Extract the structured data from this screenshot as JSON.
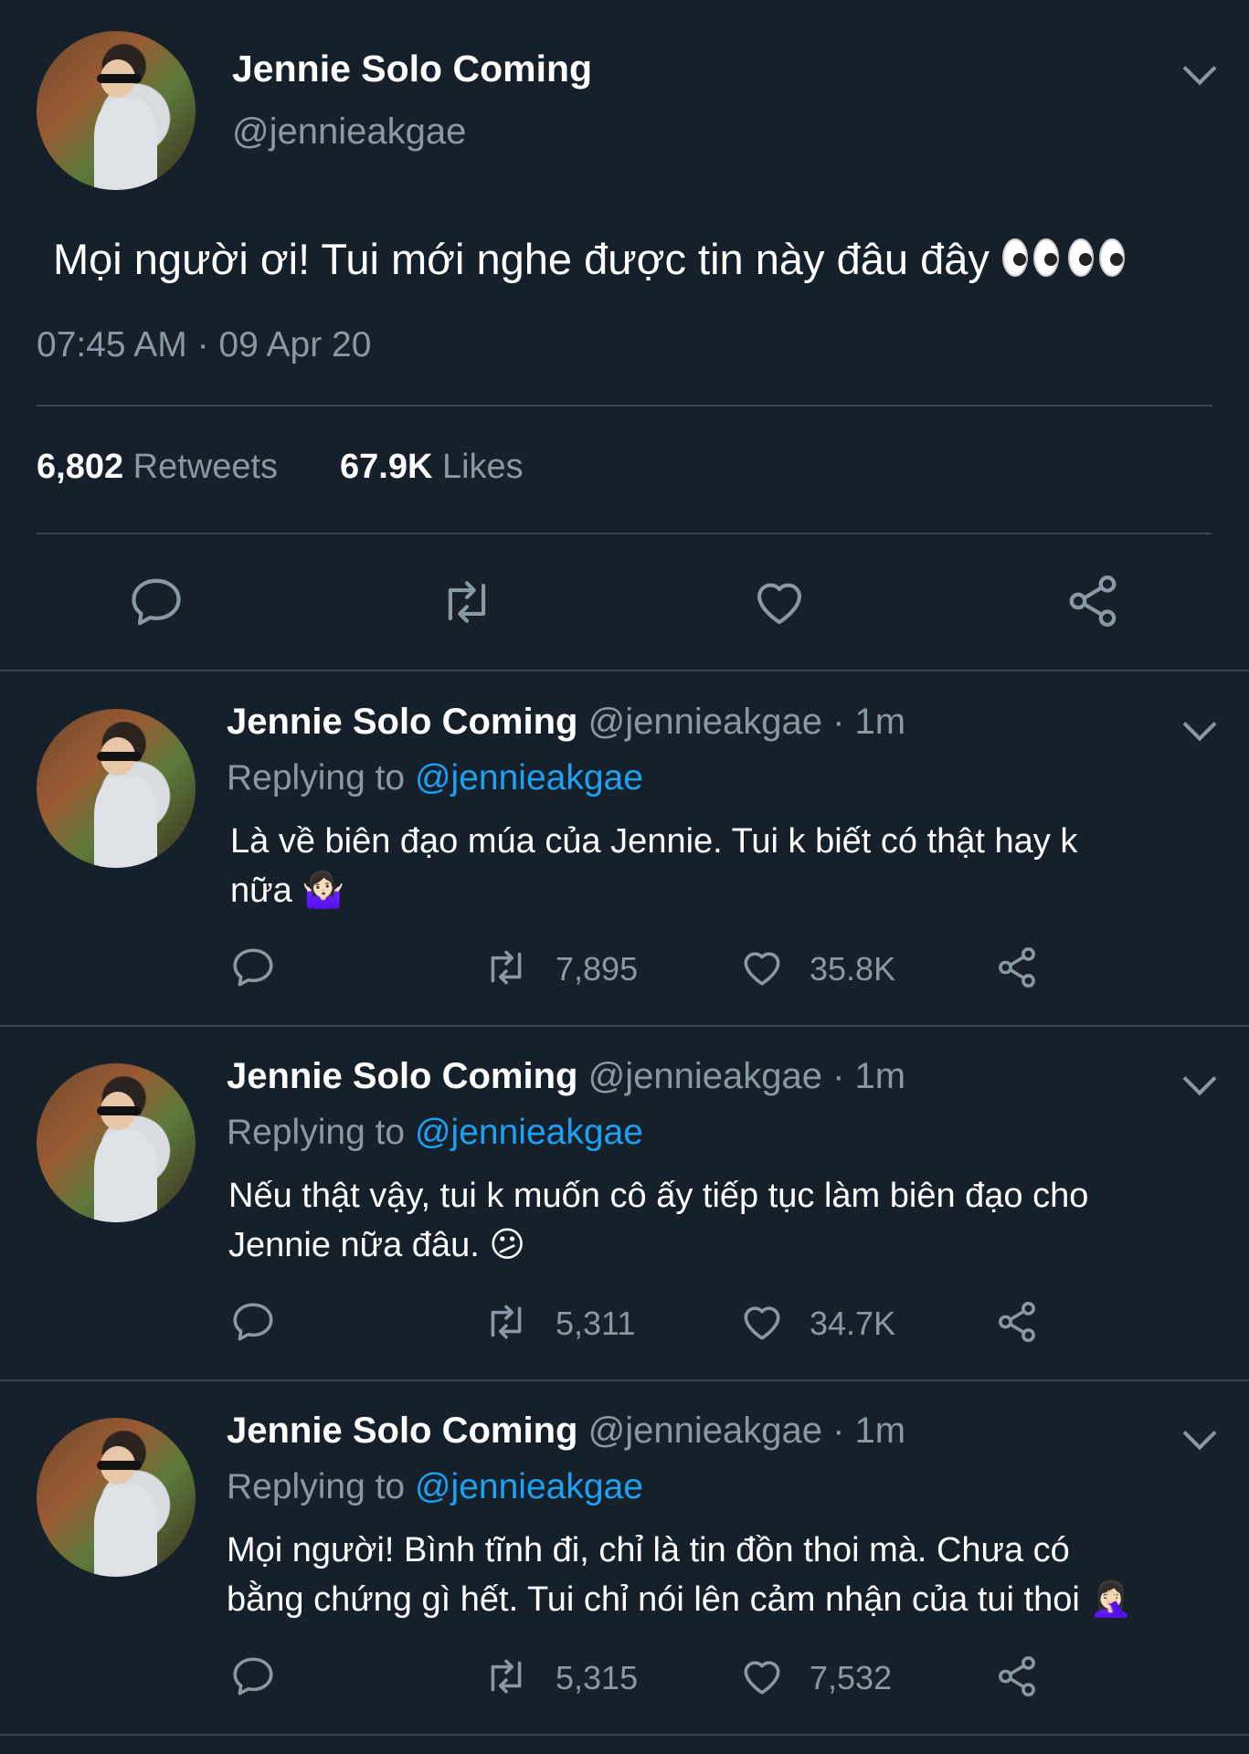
{
  "main_tweet": {
    "author_name": "Jennie Solo Coming",
    "handle": "@jennieakgae",
    "text": "Mọi người ơi! Tui mới nghe được tin này đâu đây",
    "timestamp": "07:45 AM · 09 Apr 20",
    "retweets_count": "6,802",
    "retweets_label": "Retweets",
    "likes_count": "67.9K",
    "likes_label": "Likes"
  },
  "replies": [
    {
      "author_name": "Jennie Solo Coming",
      "handle_time": "@jennieakgae · 1m",
      "replying_label": "Replying to",
      "replying_to": "@jennieakgae",
      "text_line1": "Là về biên đạo múa của Jennie. Tui k biết có thật hay k",
      "text_line2": "nữa 🤷🏻‍♀️",
      "retweets": "7,895",
      "likes": "35.8K"
    },
    {
      "author_name": "Jennie Solo Coming",
      "handle_time": "@jennieakgae · 1m",
      "replying_label": "Replying to",
      "replying_to": "@jennieakgae",
      "text_line1": "Nếu thật vậy, tui k muốn cô ấy tiếp tục làm biên đạo cho",
      "text_line2": "Jennie nữa đâu. 😕",
      "retweets": "5,311",
      "likes": "34.7K"
    },
    {
      "author_name": "Jennie Solo Coming",
      "handle_time": "@jennieakgae · 1m",
      "replying_label": "Replying to",
      "replying_to": "@jennieakgae",
      "text_line1": "Mọi người! Bình tĩnh đi, chỉ là tin đồn thoi mà. Chưa có",
      "text_line2": "bằng chứng gì hết. Tui chỉ nói lên cảm nhận của tui thoi 🤦🏻‍♀️",
      "retweets": "5,315",
      "likes": "7,532"
    }
  ],
  "icons": [
    "reply-icon",
    "retweet-icon",
    "like-icon",
    "share-icon",
    "chevron-down-icon",
    "eyes-emoji-icon"
  ],
  "colors": {
    "background": "#15202b",
    "text": "#ffffff",
    "muted": "#8899a6",
    "link": "#1da1f2",
    "divider": "#38444d"
  }
}
